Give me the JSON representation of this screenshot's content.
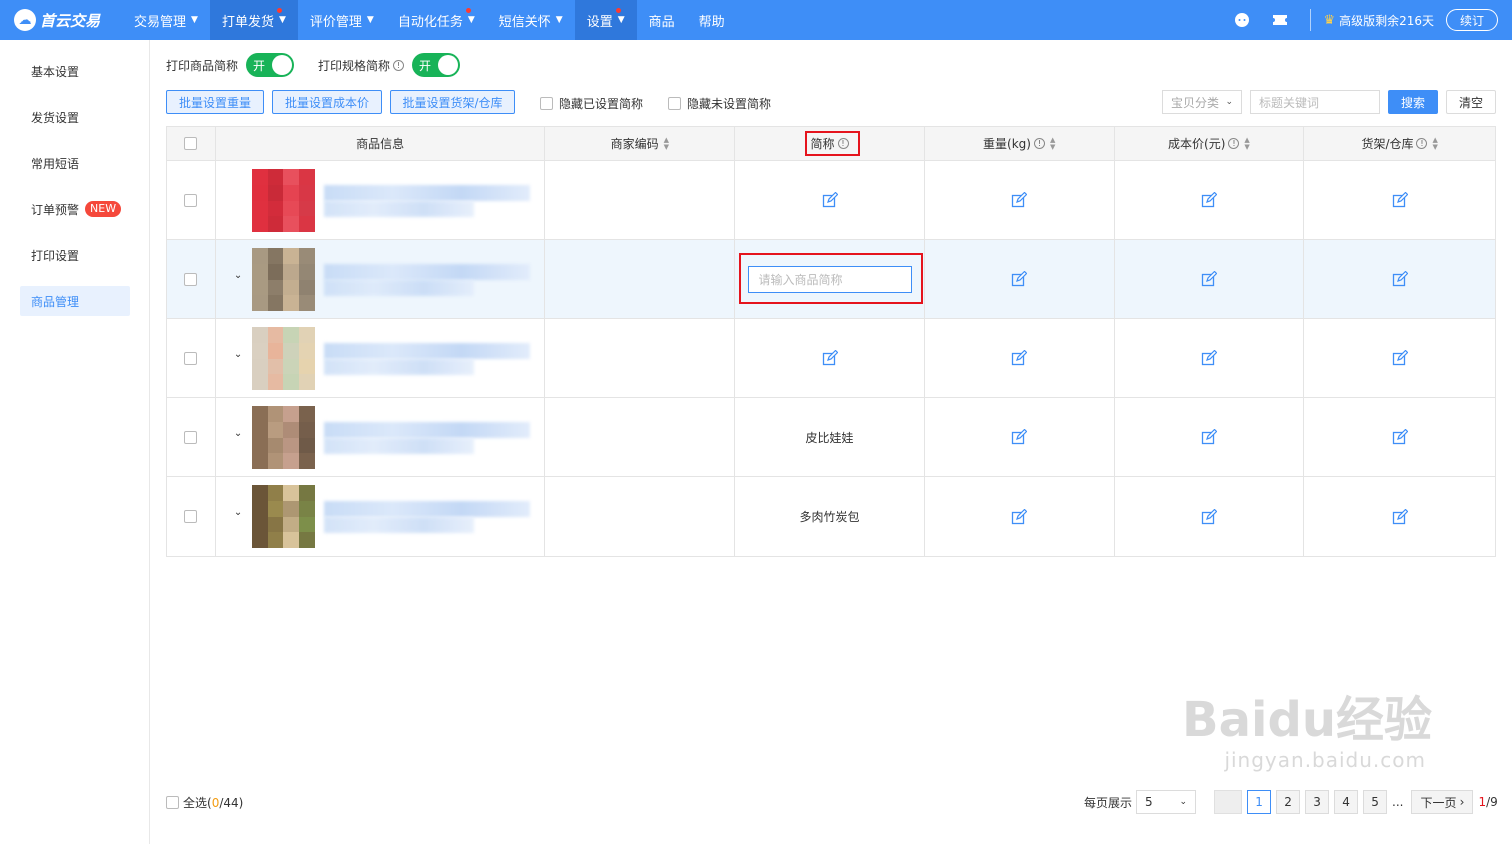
{
  "brand": {
    "name": "首云交易"
  },
  "nav": [
    {
      "label": "交易管理",
      "caret": true,
      "dot": false,
      "active": false
    },
    {
      "label": "打单发货",
      "caret": true,
      "dot": true,
      "active": true
    },
    {
      "label": "评价管理",
      "caret": true,
      "dot": false,
      "active": false
    },
    {
      "label": "自动化任务",
      "caret": true,
      "dot": true,
      "active": false
    },
    {
      "label": "短信关怀",
      "caret": true,
      "dot": false,
      "active": false
    },
    {
      "label": "设置",
      "caret": true,
      "dot": true,
      "active": true
    },
    {
      "label": "商品",
      "caret": false,
      "dot": false,
      "active": false
    },
    {
      "label": "帮助",
      "caret": false,
      "dot": false,
      "active": false
    }
  ],
  "header_right": {
    "vip_text": "高级版剩余216天",
    "renew_label": "续订"
  },
  "sidebar": [
    {
      "label": "基本设置",
      "active": false,
      "badge": ""
    },
    {
      "label": "发货设置",
      "active": false,
      "badge": ""
    },
    {
      "label": "常用短语",
      "active": false,
      "badge": ""
    },
    {
      "label": "订单预警",
      "active": false,
      "badge": "NEW"
    },
    {
      "label": "打印设置",
      "active": false,
      "badge": ""
    },
    {
      "label": "商品管理",
      "active": true,
      "badge": ""
    }
  ],
  "controls": {
    "print_short_name": "打印商品简称",
    "print_spec_short_name": "打印规格简称",
    "toggle_on": "开",
    "batch_weight": "批量设置重量",
    "batch_cost": "批量设置成本价",
    "batch_shelf": "批量设置货架/仓库",
    "hide_set": "隐藏已设置简称",
    "hide_unset": "隐藏未设置简称",
    "category_placeholder": "宝贝分类",
    "keyword_placeholder": "标题关键词",
    "search": "搜索",
    "clear": "清空"
  },
  "table": {
    "headers": [
      "商品信息",
      "商家编码",
      "简称",
      "重量(kg)",
      "成本价(元)",
      "货架/仓库"
    ],
    "input_placeholder": "请输入商品简称",
    "rows": [
      {
        "short_name": "",
        "editing": false
      },
      {
        "short_name": "",
        "editing": true
      },
      {
        "short_name": "",
        "editing": false
      },
      {
        "short_name": "皮比娃娃",
        "editing": false
      },
      {
        "short_name": "多肉竹炭包",
        "editing": false
      }
    ]
  },
  "footer": {
    "select_all": "全选(",
    "selected": "0",
    "total": "/44)",
    "per_page_label": "每页展示",
    "per_page": "5",
    "pages": [
      "1",
      "2",
      "3",
      "4",
      "5"
    ],
    "ellipsis": "...",
    "next": "下一页",
    "current": "1",
    "page_total": "/9"
  },
  "watermark": {
    "main": "Baidu经验",
    "sub": "jingyan.baidu.com"
  },
  "colors": {
    "primary": "#3e8ef7",
    "toggle": "#18b358",
    "highlight_box": "#e5141d"
  }
}
